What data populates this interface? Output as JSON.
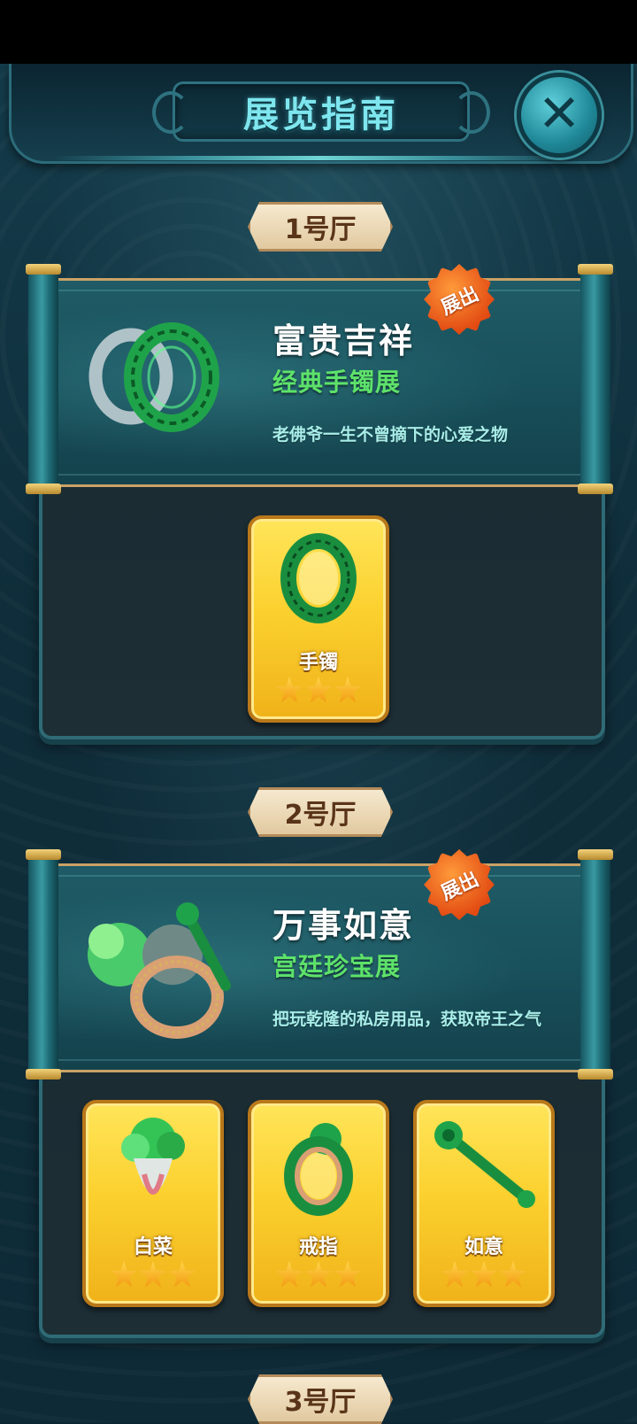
{
  "header": {
    "title": "展览指南",
    "close_icon": "close-icon"
  },
  "halls": [
    {
      "tag": "1号厅",
      "badge": "展出",
      "title": "富贵吉祥",
      "subtitle": "经典手镯展",
      "description": "老佛爷一生不曾摘下的心爱之物",
      "items": [
        {
          "name": "手镯",
          "stars": 3,
          "icon": "jade-bracelet-icon"
        }
      ]
    },
    {
      "tag": "2号厅",
      "badge": "展出",
      "title": "万事如意",
      "subtitle": "宫廷珍宝展",
      "description": "把玩乾隆的私房用品，获取帝王之气",
      "items": [
        {
          "name": "白菜",
          "stars": 3,
          "icon": "jade-cabbage-icon"
        },
        {
          "name": "戒指",
          "stars": 3,
          "icon": "jade-ring-icon"
        },
        {
          "name": "如意",
          "stars": 3,
          "icon": "ruyi-scepter-icon"
        }
      ]
    },
    {
      "tag": "3号厅"
    }
  ],
  "colors": {
    "accent": "#7ee6ef",
    "subtitle": "#5ee26a",
    "card": "#fbd12f",
    "badge": "#e24a12"
  }
}
